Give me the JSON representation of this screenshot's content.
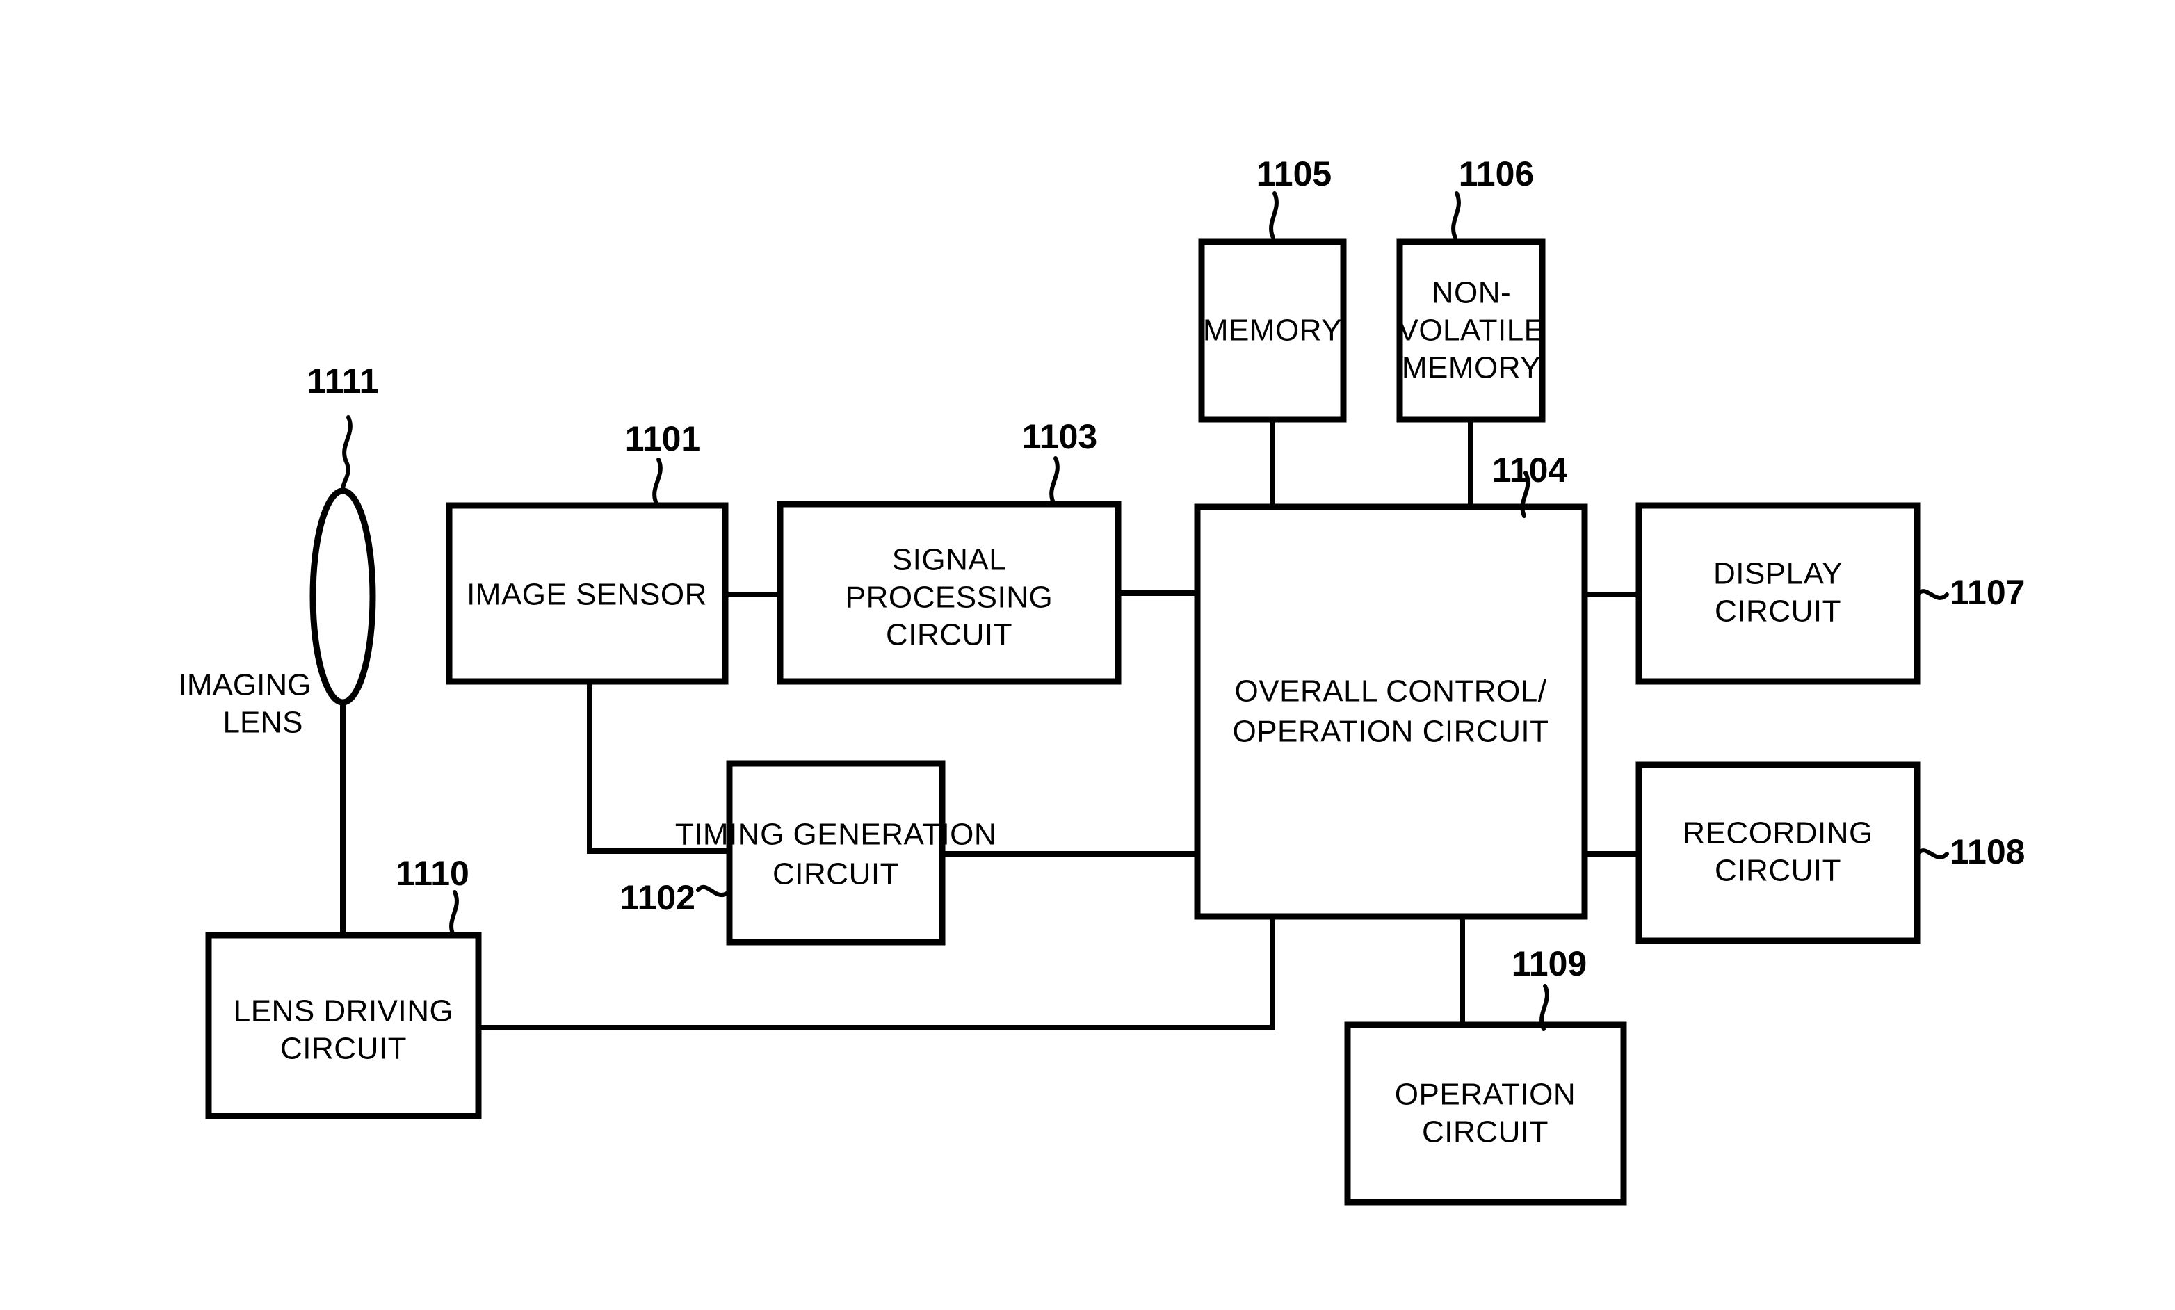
{
  "figure": {
    "type": "block-diagram",
    "title": "Imaging apparatus block diagram",
    "background_color": "#ffffff",
    "line_color": "#000000"
  },
  "blocks": {
    "image_sensor": {
      "label": "IMAGE SENSOR",
      "ref": "1101"
    },
    "timing_generation": {
      "label_line1": "TIMING GENERATION",
      "label_line2": "CIRCUIT",
      "ref": "1102"
    },
    "signal_processing": {
      "label_line1": "SIGNAL",
      "label_line2": "PROCESSING",
      "label_line3": "CIRCUIT",
      "ref": "1103"
    },
    "overall_control": {
      "label_line1": "OVERALL CONTROL/",
      "label_line2": "OPERATION CIRCUIT",
      "ref": "1104"
    },
    "memory": {
      "label": "MEMORY",
      "ref": "1105"
    },
    "nonvolatile_memory": {
      "label_line1": "NON-",
      "label_line2": "VOLATILE",
      "label_line3": "MEMORY",
      "ref": "1106"
    },
    "display_circuit": {
      "label_line1": "DISPLAY",
      "label_line2": "CIRCUIT",
      "ref": "1107"
    },
    "recording_circuit": {
      "label_line1": "RECORDING",
      "label_line2": "CIRCUIT",
      "ref": "1108"
    },
    "operation_circuit": {
      "label_line1": "OPERATION",
      "label_line2": "CIRCUIT",
      "ref": "1109"
    },
    "lens_driving": {
      "label_line1": "LENS DRIVING",
      "label_line2": "CIRCUIT",
      "ref": "1110"
    },
    "imaging_lens": {
      "label_line1": "IMAGING",
      "label_line2": "LENS",
      "ref": "1111"
    }
  }
}
